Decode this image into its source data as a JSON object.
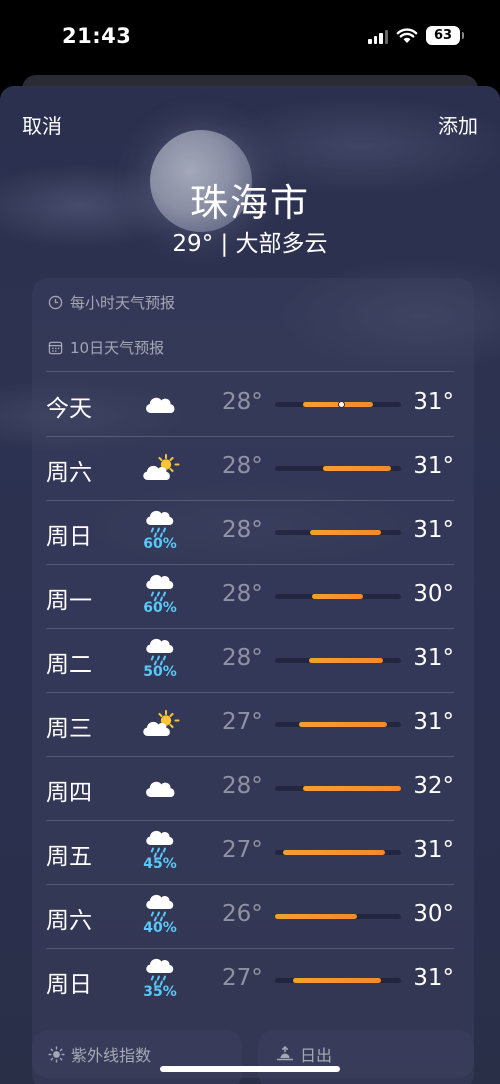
{
  "status": {
    "time": "21:43",
    "battery": "63"
  },
  "nav": {
    "cancel": "取消",
    "add": "添加"
  },
  "location": {
    "city": "珠海市",
    "summary": "29° | 大部多云"
  },
  "sections": {
    "hourly": "每小时天气预报",
    "daily": "10日天气预报",
    "uv": "紫外线指数",
    "sunrise": "日出"
  },
  "colors": {
    "accent": "#f58a27",
    "precip": "#5ac8fa",
    "background": "#2c304f"
  },
  "forecast": [
    {
      "day": "今天",
      "icon": "cloud-icon",
      "precip": "",
      "low": "28°",
      "high": "31°",
      "range": [
        0.22,
        0.78
      ],
      "current": 0.53
    },
    {
      "day": "周六",
      "icon": "partly-sunny-icon",
      "precip": "",
      "low": "28°",
      "high": "31°",
      "range": [
        0.38,
        0.92
      ]
    },
    {
      "day": "周日",
      "icon": "rain-cloud-icon",
      "precip": "60%",
      "low": "28°",
      "high": "31°",
      "range": [
        0.28,
        0.84
      ]
    },
    {
      "day": "周一",
      "icon": "rain-cloud-icon",
      "precip": "60%",
      "low": "28°",
      "high": "30°",
      "range": [
        0.29,
        0.7
      ]
    },
    {
      "day": "周二",
      "icon": "rain-cloud-icon",
      "precip": "50%",
      "low": "28°",
      "high": "31°",
      "range": [
        0.27,
        0.86
      ]
    },
    {
      "day": "周三",
      "icon": "partly-sunny-icon",
      "precip": "",
      "low": "27°",
      "high": "31°",
      "range": [
        0.19,
        0.89
      ]
    },
    {
      "day": "周四",
      "icon": "cloud-icon",
      "precip": "",
      "low": "28°",
      "high": "32°",
      "range": [
        0.22,
        1.0
      ]
    },
    {
      "day": "周五",
      "icon": "rain-cloud-icon",
      "precip": "45%",
      "low": "27°",
      "high": "31°",
      "range": [
        0.06,
        0.87
      ]
    },
    {
      "day": "周六",
      "icon": "rain-cloud-icon",
      "precip": "40%",
      "low": "26°",
      "high": "30°",
      "range": [
        0.0,
        0.65
      ]
    },
    {
      "day": "周日",
      "icon": "rain-cloud-icon",
      "precip": "35%",
      "low": "27°",
      "high": "31°",
      "range": [
        0.14,
        0.84
      ]
    }
  ]
}
